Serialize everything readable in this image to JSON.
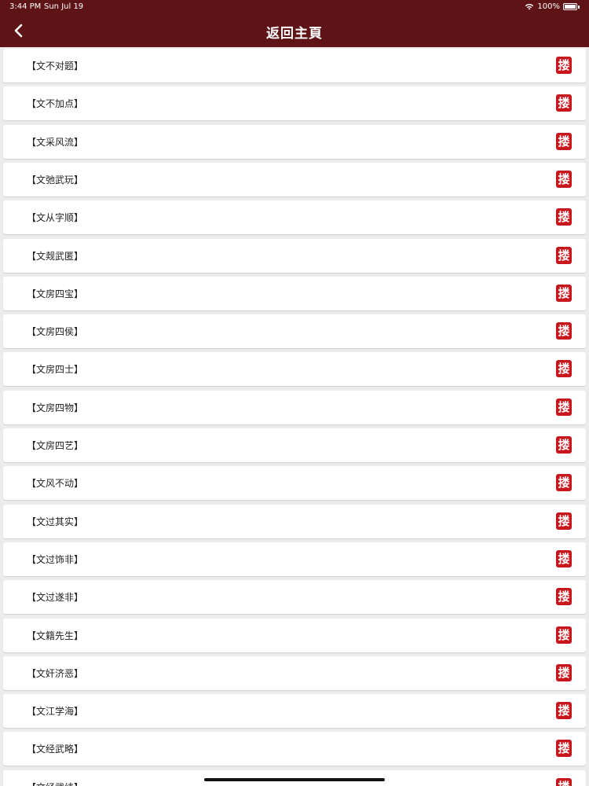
{
  "status": {
    "time": "3:44 PM",
    "date": "Sun Jul 19",
    "battery": "100%",
    "wifi_icon": "wifi-icon",
    "battery_icon": "battery-icon"
  },
  "header": {
    "title": "返回主頁",
    "back_icon": "chevron-left-icon",
    "background": "#5e1416"
  },
  "stamp": {
    "glyph": "搂",
    "color": "#c8161d"
  },
  "items": [
    {
      "label": "【文不对题】"
    },
    {
      "label": "【文不加点】"
    },
    {
      "label": "【文采风流】"
    },
    {
      "label": "【文弛武玩】"
    },
    {
      "label": "【文从字顺】"
    },
    {
      "label": "【文觌武匿】"
    },
    {
      "label": "【文房四宝】"
    },
    {
      "label": "【文房四侯】"
    },
    {
      "label": "【文房四士】"
    },
    {
      "label": "【文房四物】"
    },
    {
      "label": "【文房四艺】"
    },
    {
      "label": "【文风不动】"
    },
    {
      "label": "【文过其实】"
    },
    {
      "label": "【文过饰非】"
    },
    {
      "label": "【文过遂非】"
    },
    {
      "label": "【文籍先生】"
    },
    {
      "label": "【文奸济恶】"
    },
    {
      "label": "【文江学海】"
    },
    {
      "label": "【文经武略】"
    },
    {
      "label": "【文经武纬】"
    }
  ]
}
